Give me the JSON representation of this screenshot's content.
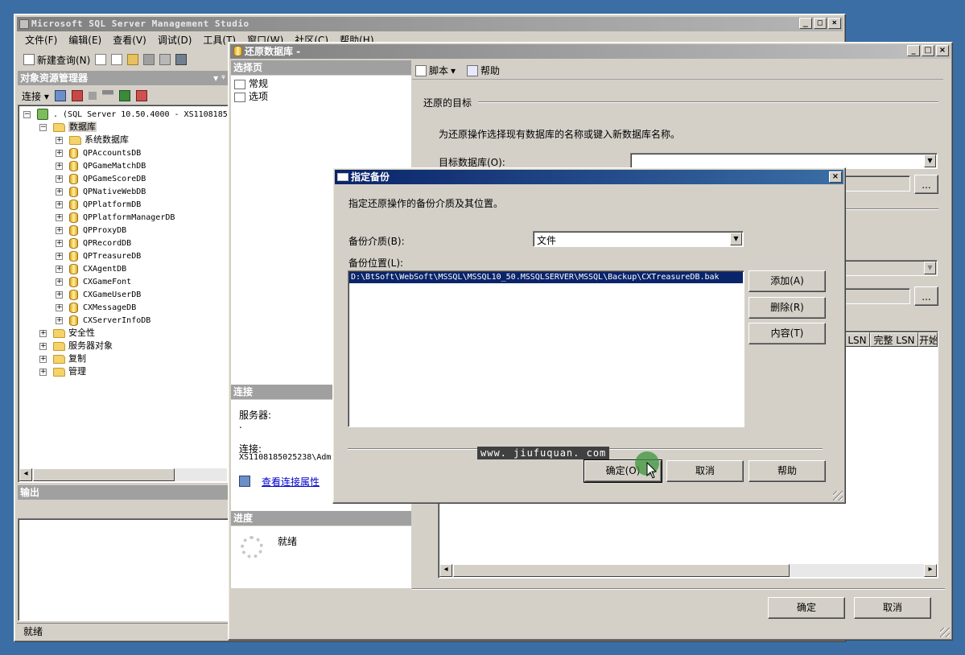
{
  "main_window": {
    "title": "Microsoft SQL Server Management Studio",
    "menu": [
      "文件(F)",
      "编辑(E)",
      "查看(V)",
      "调试(D)",
      "工具(T)",
      "窗口(W)",
      "社区(C)",
      "帮助(H)"
    ],
    "toolbar_new_query": "新建查询(N)",
    "status": "就绪"
  },
  "object_explorer": {
    "title": "对象资源管理器",
    "pin": "▾ ᵠ",
    "connect_label": "连接",
    "server_node": ". (SQL Server 10.50.4000 - XS1108185",
    "databases_label": "数据库",
    "system_db_label": "系统数据库",
    "databases": [
      "QPAccountsDB",
      "QPGameMatchDB",
      "QPGameScoreDB",
      "QPNativeWebDB",
      "QPPlatformDB",
      "QPPlatformManagerDB",
      "QPProxyDB",
      "QPRecordDB",
      "QPTreasureDB",
      "CXAgentDB",
      "CXGameFont",
      "CXGameUserDB",
      "CXMessageDB",
      "CXServerInfoDB"
    ],
    "other_nodes": [
      "安全性",
      "服务器对象",
      "复制",
      "管理"
    ]
  },
  "output_panel": {
    "title": "输出"
  },
  "restore_window": {
    "title": "还原数据库 -",
    "select_page_title": "选择页",
    "pages": [
      "常规",
      "选项"
    ],
    "script_label": "脚本",
    "help_label": "帮助",
    "target_section": "还原的目标",
    "target_desc": "为还原操作选择现有数据库的名称或键入新数据库名称。",
    "target_db_label": "目标数据库(O):",
    "browse": "...",
    "grid_headers": [
      "LSN",
      "完整 LSN",
      "开始"
    ],
    "connection_title": "连接",
    "server_label": "服务器:",
    "server_value": ".",
    "connection_label": "连接:",
    "connection_value": "XS1108185025238\\Adm",
    "view_conn_props": "查看连接属性",
    "progress_title": "进度",
    "progress_status": "就绪",
    "ok": "确定",
    "cancel": "取消"
  },
  "backup_dialog": {
    "title": "指定备份",
    "desc": "指定还原操作的备份介质及其位置。",
    "media_label": "备份介质(B):",
    "media_value": "文件",
    "location_label": "备份位置(L):",
    "location_items": [
      "D:\\BtSoft\\WebSoft\\MSSQL\\MSSQL10_50.MSSQLSERVER\\MSSQL\\Backup\\CXTreasureDB.bak"
    ],
    "add": "添加(A)",
    "remove": "删除(R)",
    "contents": "内容(T)",
    "ok": "确定(O)",
    "cancel": "取消",
    "help": "帮助"
  },
  "watermark": "www. jiufuquan. com"
}
